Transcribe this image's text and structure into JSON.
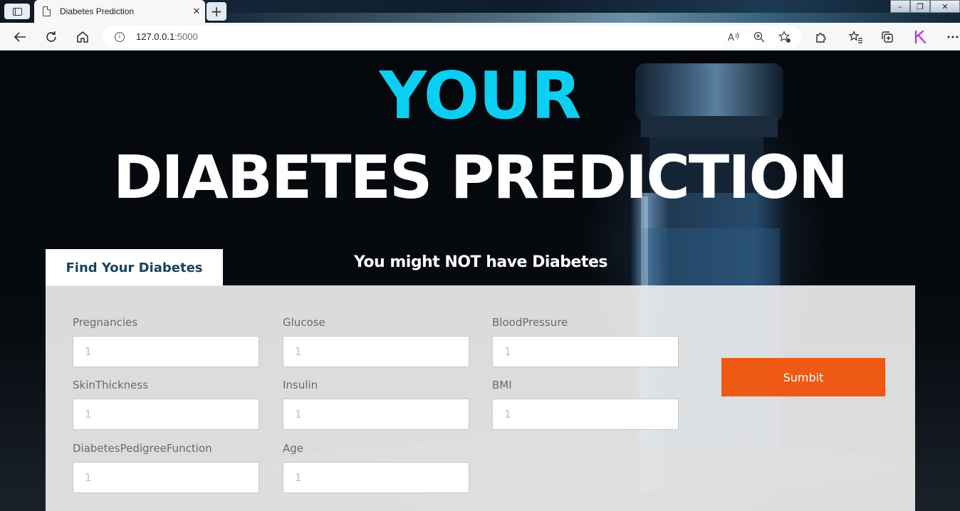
{
  "browser": {
    "tab_title": "Diabetes Prediction",
    "tab_close": "✕",
    "new_tab": "+",
    "url_host": "127.0.0.1",
    "url_port": ":5000",
    "window_controls": [
      "–",
      "❐",
      "✕"
    ]
  },
  "hero": {
    "line1": "YOUR",
    "line2": "DIABETES PREDICTION"
  },
  "form": {
    "tab_label": "Find Your Diabetes",
    "result_text": "You might NOT have Diabetes",
    "submit_label": "Sumbit",
    "fields": [
      {
        "label": "Pregnancies",
        "placeholder": "1"
      },
      {
        "label": "Glucose",
        "placeholder": "1"
      },
      {
        "label": "BloodPressure",
        "placeholder": "1"
      },
      {
        "label": "SkinThickness",
        "placeholder": "1"
      },
      {
        "label": "Insulin",
        "placeholder": "1"
      },
      {
        "label": "BMI",
        "placeholder": "1"
      },
      {
        "label": "DiabetesPedigreeFunction",
        "placeholder": "1"
      },
      {
        "label": "Age",
        "placeholder": "1"
      }
    ]
  },
  "colors": {
    "accent_cyan": "#0bcff2",
    "submit_orange": "#ee5a14",
    "tab_text_navy": "#1a4261"
  },
  "icons": [
    "tab-actions-icon",
    "page-icon",
    "back-icon",
    "refresh-icon",
    "home-icon",
    "info-icon",
    "read-aloud-icon",
    "zoom-icon",
    "add-favorite-icon",
    "extensions-icon",
    "favorites-icon",
    "collections-icon",
    "profile-icon",
    "more-icon"
  ]
}
